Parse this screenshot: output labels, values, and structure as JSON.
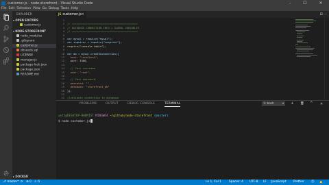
{
  "window": {
    "title": "customer.js - node-storefront - Visual Studio Code",
    "minimize": "–",
    "maximize": "☐",
    "close": "✕"
  },
  "menu": [
    "File",
    "Edit",
    "Selection",
    "View",
    "Go",
    "Debug",
    "Tasks",
    "Help"
  ],
  "activity": {
    "explorer": "explorer-icon",
    "search": "search-icon",
    "scm": "source-control-icon",
    "debug": "debug-icon",
    "extensions": "extensions-icon",
    "settings": "gear-icon"
  },
  "sidebar": {
    "title": "EXPLORER",
    "open_editors": "▾ OPEN EDITORS",
    "open_file": "customer.js",
    "project": "▾ NODE-STOREFRONT",
    "files": [
      {
        "name": "node_modules",
        "color": "#c5c5c5"
      },
      {
        "name": ".gitignore",
        "color": "#c5c5c5"
      },
      {
        "name": "customer.js",
        "color": "#cbcb41"
      },
      {
        "name": "dbseeds.sql",
        "color": "#e37933"
      },
      {
        "name": "LICENSE",
        "color": "#cc3e44"
      },
      {
        "name": "manager.js",
        "color": "#cbcb41"
      },
      {
        "name": "package-lock.json",
        "color": "#cbcb41"
      },
      {
        "name": "package.json",
        "color": "#cbcb41"
      },
      {
        "name": "README.md",
        "color": "#519aba"
      }
    ],
    "outline": "▸ DOCKER"
  },
  "tab": {
    "badge": "JS",
    "label": "customer.js",
    "close": "×"
  },
  "tab_actions": "⊟ ···",
  "code": {
    "line_numbers": [
      "1",
      "2",
      "3",
      "4",
      "5",
      "6",
      "7",
      "8",
      "9",
      "10",
      "11",
      "12",
      "13",
      "14",
      "15",
      "16",
      "17",
      "18",
      "19",
      "20",
      "21",
      "22"
    ],
    "lines": [
      "",
      "// ==========================================",
      "// DATABASE CONNECTION INFO + GLOBAL VARIABLES",
      "// ==========================================",
      "",
      "var mysql = require(\"mysql\");",
      "var inquirer = require(\"inquirer\");",
      "require(\"console.table\");",
      "",
      "var db = mysql.createConnection({",
      "  host: \"localhost\",",
      "  port: 3306,",
      "",
      "  // Your username",
      "  user: \"root\",",
      "",
      "  // Your password",
      "  password: \"\",",
      "  database: \"storefront_db\"",
      "});",
      "",
      "//validate connection to database"
    ]
  },
  "panel": {
    "tabs": [
      "PROBLEMS",
      "OUTPUT",
      "DEBUG CONSOLE",
      "TERMINAL"
    ],
    "dropdown": "1: bash",
    "add": "+",
    "trash": "🗑",
    "maximize": "^",
    "close": "✕",
    "prompt_user": "yetz@DESKTOP-HHUMIST",
    "prompt_host": "MINGW64",
    "prompt_path": "~/github/node-storefront",
    "prompt_branch": "(master)",
    "command": "$ node customer.js"
  },
  "status": {
    "branch": "⎇ master*",
    "sync": "⟳",
    "errors": "⊗ 0",
    "warnings": "⚠ 0",
    "position": "Ln 1, Col 1",
    "spaces": "Spaces: 4",
    "encoding": "UTF-8",
    "eol": "LF",
    "language": "JavaScript",
    "formatter": "Prettier",
    "smiley": "☺",
    "bell": "🔔"
  }
}
